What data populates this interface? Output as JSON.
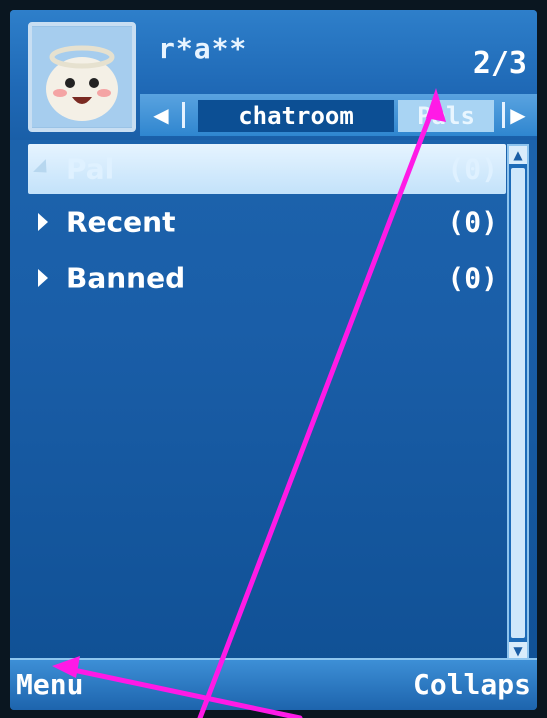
{
  "header": {
    "username": "r*a**",
    "page_counter": "2/3"
  },
  "tabs": {
    "left_arrow": "◀",
    "right_arrow": "▶",
    "items": [
      {
        "label": "chatroom",
        "selected": false
      },
      {
        "label": "Pals",
        "selected": true
      }
    ]
  },
  "list": {
    "rows": [
      {
        "label": "Pal",
        "count": "(0)",
        "selected": true,
        "expanded": true
      },
      {
        "label": "Recent",
        "count": "(0)",
        "selected": false,
        "expanded": false
      },
      {
        "label": "Banned",
        "count": "(0)",
        "selected": false,
        "expanded": false
      }
    ]
  },
  "softkeys": {
    "left": "Menu",
    "right": "Collaps"
  },
  "colors": {
    "screen_bg": "#1a5ea8",
    "tab_selected": "#a9d4f3",
    "annotation_arrow": "#ff1ae6"
  }
}
